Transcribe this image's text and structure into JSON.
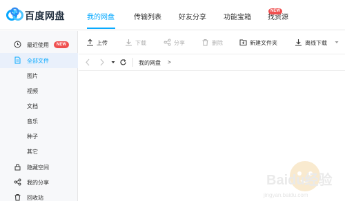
{
  "app": {
    "name": "百度网盘"
  },
  "nav": {
    "tabs": [
      {
        "label": "我的网盘",
        "active": true
      },
      {
        "label": "传输列表",
        "active": false
      },
      {
        "label": "好友分享",
        "active": false
      },
      {
        "label": "功能宝箱",
        "active": false
      },
      {
        "label": "找资源",
        "active": false,
        "badge": "NEW"
      }
    ]
  },
  "sidebar": {
    "items": [
      {
        "label": "最近使用",
        "icon": "clock-icon",
        "badge": "NEW"
      },
      {
        "label": "全部文件",
        "icon": "file-icon",
        "active": true
      },
      {
        "label": "图片"
      },
      {
        "label": "视频"
      },
      {
        "label": "文档"
      },
      {
        "label": "音乐"
      },
      {
        "label": "种子"
      },
      {
        "label": "其它"
      },
      {
        "label": "隐藏空间",
        "icon": "lock-icon"
      },
      {
        "label": "我的分享",
        "icon": "share-icon"
      },
      {
        "label": "回收站",
        "icon": "trash-icon"
      }
    ]
  },
  "toolbar": {
    "upload": "上传",
    "download": "下载",
    "share": "分享",
    "delete": "删除",
    "new_folder": "新建文件夹",
    "offline_download": "离线下载"
  },
  "path": {
    "crumb": "我的网盘",
    "separator": ">"
  },
  "watermark": {
    "text": "Baidu经验",
    "url": "jingyan.baidu.com"
  },
  "colors": {
    "accent": "#09aaff",
    "badge": "#ef4f4f",
    "sidebar_bg": "#f7f8fa",
    "active_bg": "#e9f0fb"
  }
}
